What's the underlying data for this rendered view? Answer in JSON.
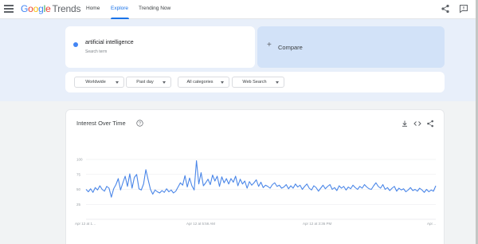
{
  "header": {
    "logo_google": [
      "G",
      "o",
      "o",
      "g",
      "l",
      "e"
    ],
    "logo_trends": "Trends",
    "tabs": [
      {
        "label": "Home"
      },
      {
        "label": "Explore"
      },
      {
        "label": "Trending Now"
      }
    ],
    "active_tab": "Explore",
    "icons": [
      "menu-icon",
      "share-icon",
      "feedback-icon"
    ]
  },
  "search": {
    "term": "artificial intelligence",
    "term_type": "Search term",
    "term_color": "#4285f4",
    "compare_label": "Compare"
  },
  "filters": [
    {
      "label": "Worldwide"
    },
    {
      "label": "Past day"
    },
    {
      "label": "All categories"
    },
    {
      "label": "Web Search"
    }
  ],
  "card": {
    "title": "Interest Over Time",
    "icons": [
      "help-icon",
      "download-icon",
      "embed-icon",
      "share-icon"
    ]
  },
  "chart_data": {
    "type": "line",
    "title": "Interest Over Time",
    "ylim": [
      0,
      100
    ],
    "y_ticks": [
      "100",
      "75",
      "50",
      "25"
    ],
    "x_tick_labels": [
      "Apr 12 at 1…",
      "Apr 12 at 5:56 AM",
      "Apr 12 at 3:36 PM",
      "Apr…"
    ],
    "grid": true,
    "series": [
      {
        "color": "#4a86e8",
        "values": [
          50,
          46,
          51,
          45,
          53,
          49,
          56,
          50,
          47,
          55,
          52,
          37,
          51,
          58,
          68,
          49,
          61,
          72,
          55,
          76,
          52,
          70,
          75,
          51,
          49,
          59,
          83,
          66,
          50,
          42,
          49,
          46,
          44,
          48,
          45,
          51,
          46,
          49,
          44,
          47,
          54,
          61,
          57,
          73,
          54,
          69,
          56,
          49,
          98,
          59,
          78,
          56,
          61,
          67,
          58,
          74,
          64,
          72,
          55,
          71,
          61,
          68,
          59,
          68,
          62,
          72,
          56,
          67,
          59,
          64,
          52,
          63,
          57,
          61,
          66,
          55,
          62,
          53,
          57,
          55,
          52,
          58,
          61,
          55,
          57,
          52,
          54,
          58,
          51,
          56,
          52,
          59,
          54,
          57,
          50,
          55,
          59,
          52,
          49,
          56,
          53,
          47,
          52,
          57,
          51,
          55,
          58,
          50,
          53,
          48,
          56,
          52,
          55,
          49,
          54,
          51,
          57,
          53,
          50,
          55,
          52,
          58,
          54,
          51,
          50,
          56,
          61,
          55,
          52,
          58,
          50,
          53,
          48,
          52,
          55,
          47,
          52,
          49,
          51,
          46,
          49,
          53,
          48,
          50,
          47,
          52,
          49,
          45,
          50,
          46,
          49,
          47,
          56
        ]
      }
    ]
  }
}
